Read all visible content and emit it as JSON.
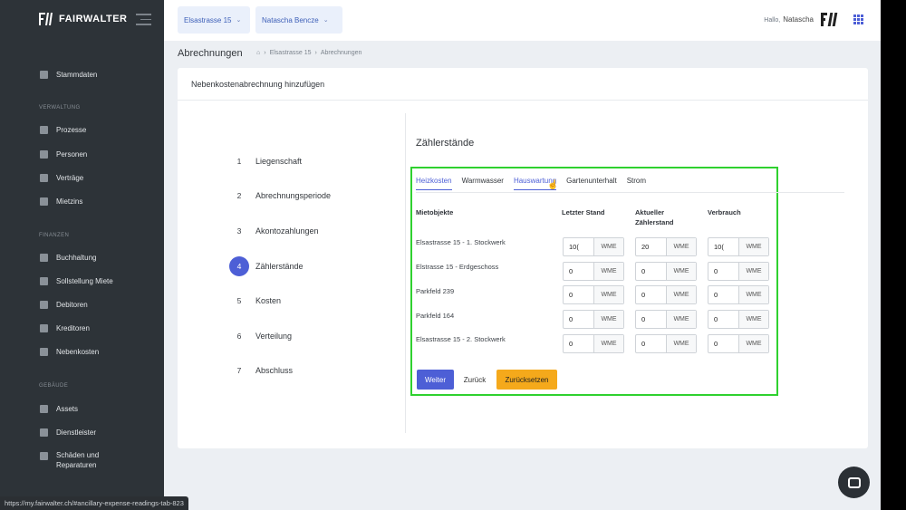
{
  "app": {
    "brand": "FAIRWALTER"
  },
  "sidebar": {
    "top_item": {
      "label": "Stammdaten",
      "icon": "database-icon"
    },
    "sections": [
      {
        "title": "VERWALTUNG",
        "items": [
          {
            "label": "Prozesse",
            "icon": "list-icon"
          },
          {
            "label": "Personen",
            "icon": "people-icon"
          },
          {
            "label": "Verträge",
            "icon": "contract-icon"
          },
          {
            "label": "Mietzins",
            "icon": "coin-icon"
          }
        ]
      },
      {
        "title": "FINANZEN",
        "items": [
          {
            "label": "Buchhaltung",
            "icon": "ledger-icon"
          },
          {
            "label": "Sollstellung Miete",
            "icon": "document-icon"
          },
          {
            "label": "Debitoren",
            "icon": "invoice-icon"
          },
          {
            "label": "Kreditoren",
            "icon": "invoice-icon"
          },
          {
            "label": "Nebenkosten",
            "icon": "flame-icon"
          }
        ]
      },
      {
        "title": "GEBÄUDE",
        "items": [
          {
            "label": "Assets",
            "icon": "building-icon"
          },
          {
            "label": "Dienstleister",
            "icon": "worker-icon"
          },
          {
            "label": "Schäden und Reparaturen",
            "icon": "wrench-icon"
          }
        ]
      }
    ]
  },
  "topbar": {
    "property_select": "Elsastrasse 15",
    "person_select": "Natascha Bencze",
    "greeting": "Hallo,",
    "user_name": "Natascha"
  },
  "breadcrumb": {
    "page_title": "Abrechnungen",
    "path": [
      "Elsastrasse 15",
      "Abrechnungen"
    ]
  },
  "card": {
    "title": "Nebenkostenabrechnung hinzufügen",
    "steps": [
      {
        "num": "1",
        "label": "Liegenschaft"
      },
      {
        "num": "2",
        "label": "Abrechnungsperiode"
      },
      {
        "num": "3",
        "label": "Akontozahlungen"
      },
      {
        "num": "4",
        "label": "Zählerstände"
      },
      {
        "num": "5",
        "label": "Kosten"
      },
      {
        "num": "6",
        "label": "Verteilung"
      },
      {
        "num": "7",
        "label": "Abschluss"
      }
    ],
    "active_step": 4,
    "section_title": "Zählerstände",
    "tabs": [
      "Heizkosten",
      "Warmwasser",
      "Hauswartung",
      "Gartenunterhalt",
      "Strom"
    ],
    "columns": {
      "object": "Mietobjekte",
      "last": "Letzter Stand",
      "current": "Aktueller Zählerstand",
      "usage": "Verbrauch"
    },
    "unit": "WME",
    "rows": [
      {
        "label": "Elsastrasse 15 - 1. Stockwerk",
        "last": "10(",
        "current": "20",
        "usage": "10("
      },
      {
        "label": "Elstrasse 15 - Erdgeschoss",
        "last": "0",
        "current": "0",
        "usage": "0"
      },
      {
        "label": "Parkfeld 239",
        "last": "0",
        "current": "0",
        "usage": "0"
      },
      {
        "label": "Parkfeld 164",
        "last": "0",
        "current": "0",
        "usage": "0"
      },
      {
        "label": "Elsastrasse 15 - 2. Stockwerk",
        "last": "0",
        "current": "0",
        "usage": "0"
      }
    ],
    "buttons": {
      "next": "Weiter",
      "back": "Zurück",
      "reset": "Zurücksetzen"
    }
  },
  "status_url": "https://my.fairwalter.ch/#ancillary-expense-readings-tab-823",
  "colors": {
    "accent": "#4d5fd6",
    "highlight": "#2fd12f",
    "warning": "#f5a91b",
    "sidebar": "#2d3338"
  }
}
